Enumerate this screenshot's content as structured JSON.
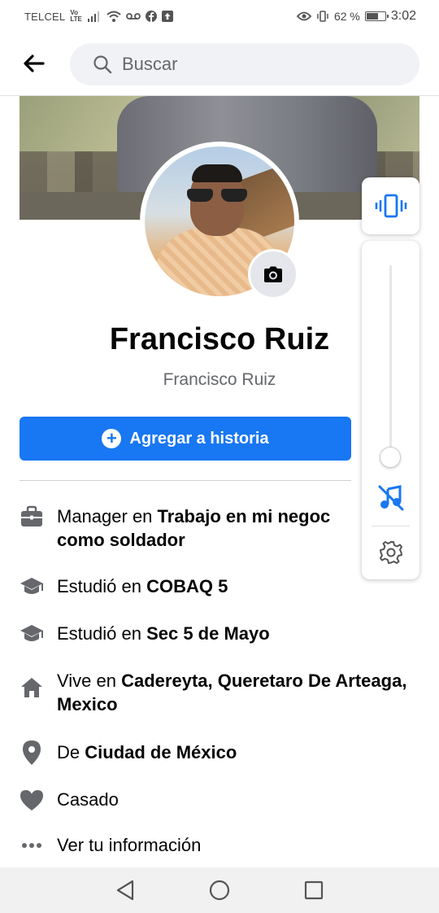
{
  "status_bar": {
    "carrier": "TELCEL",
    "network_top": "Vo",
    "network_bottom": "LTE",
    "battery_percent": "62 %",
    "battery_level": 0.62,
    "time": "3:02"
  },
  "header": {
    "search_placeholder": "Buscar"
  },
  "profile": {
    "name": "Francisco Ruiz",
    "subname": "Francisco Ruiz",
    "story_button": "Agregar a historia"
  },
  "info": {
    "work_prefix": "Manager en ",
    "work_bold_line1": "Trabajo en mi negoc",
    "work_bold_line2": "como soldador",
    "study1_prefix": "Estudió en ",
    "study1_bold": "COBAQ 5",
    "study2_prefix": "Estudió en ",
    "study2_bold": "Sec 5 de Mayo",
    "lives_prefix": "Vive en ",
    "lives_bold": "Cadereyta, Queretaro De Arteaga, Mexico",
    "from_prefix": "De ",
    "from_bold": "Ciudad de México",
    "relationship": "Casado",
    "see_more": "Ver tu información"
  },
  "sound_panel": {
    "vibrate_icon": "vibrate-icon",
    "ringer_icon": "music-off-icon",
    "settings_icon": "gear-icon",
    "volume_level": 0.0,
    "accent_color": "#1877f2"
  },
  "colors": {
    "brand": "#1877f2",
    "text": "#050505",
    "muted": "#65676b"
  }
}
